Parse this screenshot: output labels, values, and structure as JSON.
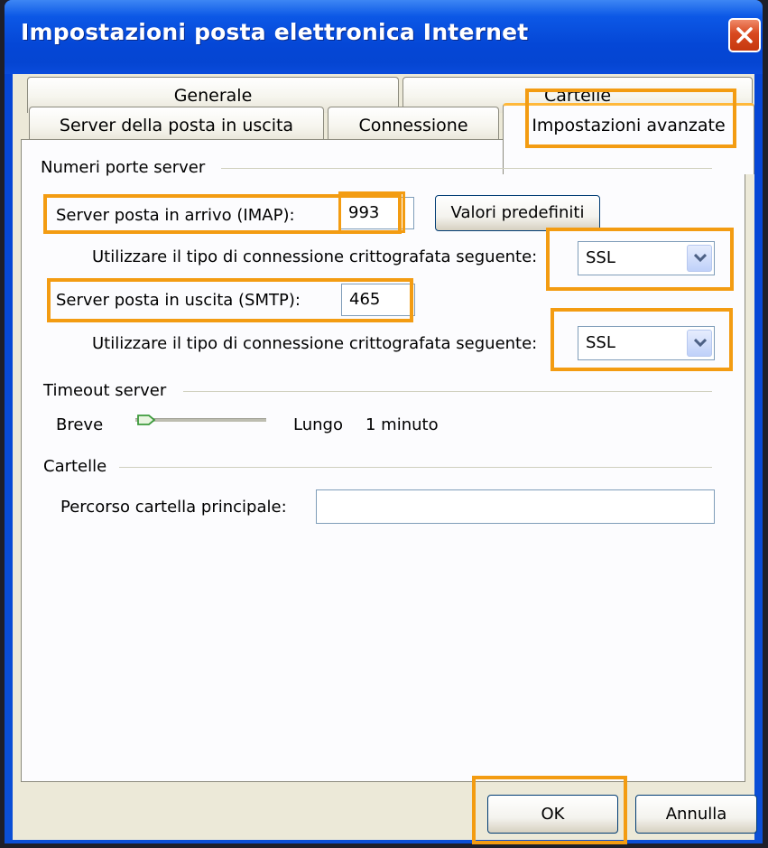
{
  "window": {
    "title": "Impostazioni posta elettronica Internet",
    "close_icon": "close-icon"
  },
  "tabs": {
    "row1": [
      "Generale",
      "Cartelle"
    ],
    "row2": [
      "Server della posta in uscita",
      "Connessione",
      "Impostazioni avanzate"
    ],
    "active": "Impostazioni avanzate"
  },
  "server_ports": {
    "group_label": "Numeri porte server",
    "incoming_label": "Server posta in arrivo (IMAP):",
    "incoming_value": "993",
    "defaults_button": "Valori predefiniti",
    "encryption_label_1": "Utilizzare il tipo di connessione crittografata seguente:",
    "encryption_value_1": "SSL",
    "outgoing_label": "Server posta in uscita (SMTP):",
    "outgoing_value": "465",
    "encryption_label_2": "Utilizzare il tipo di connessione crittografata seguente:",
    "encryption_value_2": "SSL"
  },
  "timeout": {
    "group_label": "Timeout server",
    "short_label": "Breve",
    "long_label": "Lungo",
    "value_text": "1 minuto",
    "slider_level": 0
  },
  "folders": {
    "group_label": "Cartelle",
    "root_label": "Percorso cartella principale:",
    "root_value": ""
  },
  "footer": {
    "ok": "OK",
    "cancel": "Annulla"
  },
  "colors": {
    "highlight": "#f39c12",
    "titlebar": "#0547d6",
    "dialog_bg": "#ece9d8"
  }
}
